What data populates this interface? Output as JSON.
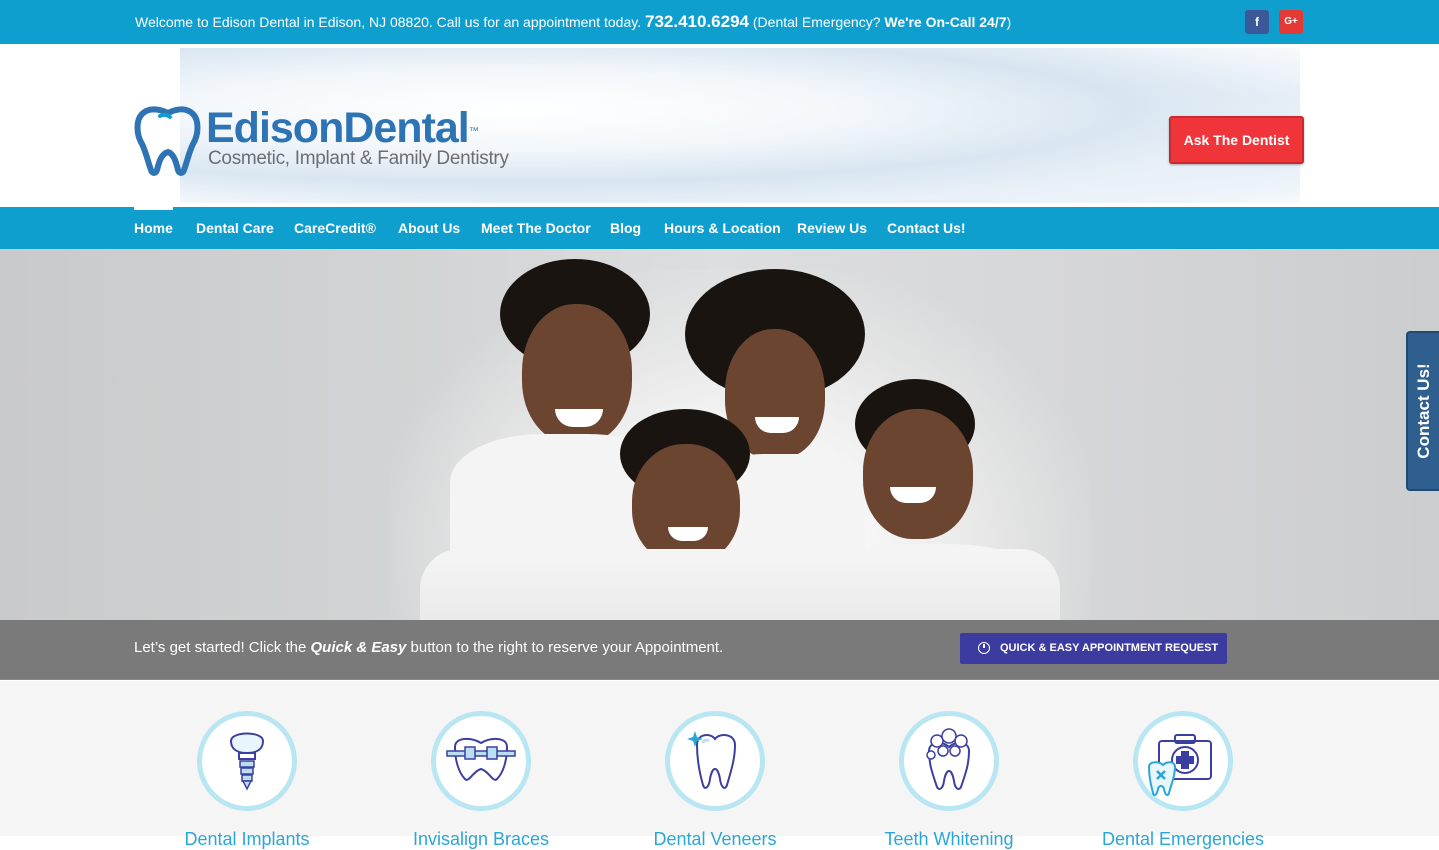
{
  "topbar": {
    "welcome": "Welcome to Edison Dental in Edison, NJ 08820. Call us for an appointment today.",
    "phone": "732.410.6294",
    "emergency_prefix": "(Dental Emergency?",
    "oncall": "We're On-Call 24/7",
    "emergency_suffix": ")",
    "social": [
      {
        "name": "facebook-icon",
        "glyph": "f",
        "color": "#3b5998"
      },
      {
        "name": "google-plus-icon",
        "glyph": "G+",
        "color": "#e53935"
      }
    ]
  },
  "header": {
    "brand": "EdisonDental",
    "trademark": "™",
    "tagline": "Cosmetic, Implant & Family Dentistry",
    "ask_button": "Ask The Dentist",
    "brand_color": "#2e74b5"
  },
  "nav": {
    "items": [
      "Home",
      "Dental Care",
      "CareCredit®",
      "About Us",
      "Meet The Doctor",
      "Blog",
      "Hours & Location",
      "Review Us",
      "Contact Us!"
    ],
    "active": "Home",
    "color": "#0f9fcf"
  },
  "hero": {
    "contact_tab": "Contact Us!"
  },
  "cta": {
    "text_before": "Let’s get started!  Click the ",
    "text_em": "Quick & Easy",
    "text_after": " button to the right to reserve your Appointment.",
    "button": "QUICK & EASY APPOINTMENT REQUEST",
    "button_color": "#3c3ba0"
  },
  "services": {
    "icons": [
      "dental-implant-icon",
      "invisalign-braces-icon",
      "dental-veneers-icon",
      "teeth-whitening-icon",
      "dental-emergency-icon"
    ],
    "labels": [
      "Dental Implants",
      "Invisalign Braces",
      "Dental Veneers",
      "Teeth Whitening",
      "Dental Emergencies"
    ],
    "ring_color": "#b8e6f3"
  }
}
